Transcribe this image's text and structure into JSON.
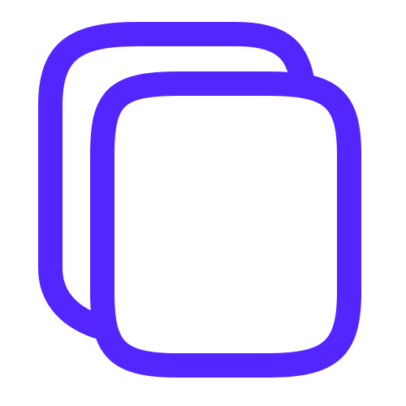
{
  "icon": {
    "name": "copy-icon",
    "stroke_color": "#5325FF",
    "background_color": "#FFFFFF"
  }
}
